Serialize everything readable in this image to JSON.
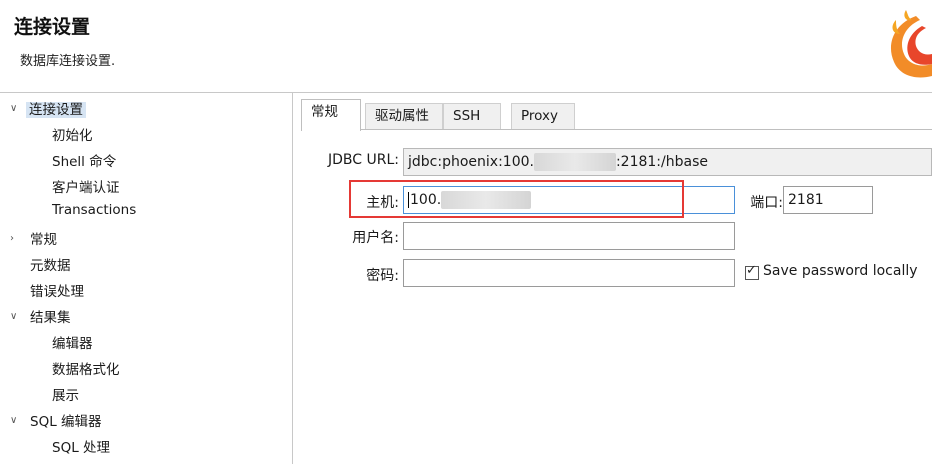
{
  "header": {
    "title": "连接设置",
    "subtitle": "数据库连接设置."
  },
  "tree": {
    "items": [
      {
        "label": "连接设置",
        "expanded": true,
        "selected": true
      },
      {
        "label": "初始化"
      },
      {
        "label": "Shell 命令"
      },
      {
        "label": "客户端认证"
      },
      {
        "label": "Transactions"
      },
      {
        "label": "常规"
      },
      {
        "label": "元数据"
      },
      {
        "label": "错误处理"
      },
      {
        "label": "结果集",
        "expanded": true
      },
      {
        "label": "编辑器"
      },
      {
        "label": "数据格式化"
      },
      {
        "label": "展示"
      },
      {
        "label": "SQL 编辑器",
        "expanded": true
      },
      {
        "label": "SQL 处理"
      }
    ]
  },
  "tabs": [
    {
      "label": "常规",
      "active": true
    },
    {
      "label": "驱动属性"
    },
    {
      "label": "SSH"
    },
    {
      "label": "Proxy"
    }
  ],
  "form": {
    "jdbc_label": "JDBC URL:",
    "jdbc_value_prefix": "jdbc:phoenix:100.",
    "jdbc_value_suffix": ":2181:/hbase",
    "host_label": "主机:",
    "host_value": "100.",
    "port_label": "端口:",
    "port_value": "2181",
    "user_label": "用户名:",
    "user_value": "",
    "password_label": "密码:",
    "password_value": "",
    "save_password_label": "Save password locally",
    "save_password_checked": true
  },
  "colors": {
    "highlight": "#e53935",
    "selection": "#d6e4f3",
    "focus_border": "#4a90d9"
  },
  "icons": {
    "logo": "dbeaver-flame-logo",
    "expand": "chevron-down-icon",
    "collapse": "chevron-right-icon"
  }
}
